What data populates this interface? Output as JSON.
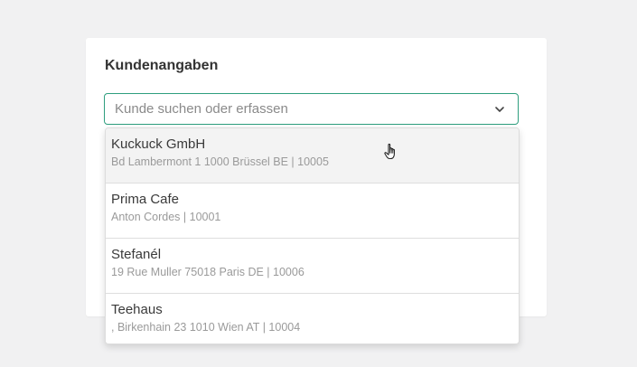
{
  "card": {
    "title": "Kundenangaben"
  },
  "search": {
    "placeholder": "Kunde suchen oder erfassen",
    "value": "",
    "dropdown_icon": "chevron-down-icon"
  },
  "dropdown": {
    "options": [
      {
        "name": "Kuckuck GmbH",
        "detail": "Bd Lambermont 1 1000 Brüssel BE | 10005",
        "hovered": true
      },
      {
        "name": "Prima Cafe",
        "detail": "Anton Cordes | 10001",
        "hovered": false
      },
      {
        "name": "Stefanél",
        "detail": "19 Rue Muller 75018 Paris DE | 10006",
        "hovered": false
      },
      {
        "name": "Teehaus",
        "detail": ", Birkenhain 23 1010 Wien AT | 10004",
        "hovered": false
      }
    ]
  },
  "colors": {
    "accent": "#2e9e7e",
    "page_background": "#f1f1f2",
    "hover_background": "#f3f3f3"
  },
  "cursor": {
    "icon": "hand-pointer-icon"
  }
}
